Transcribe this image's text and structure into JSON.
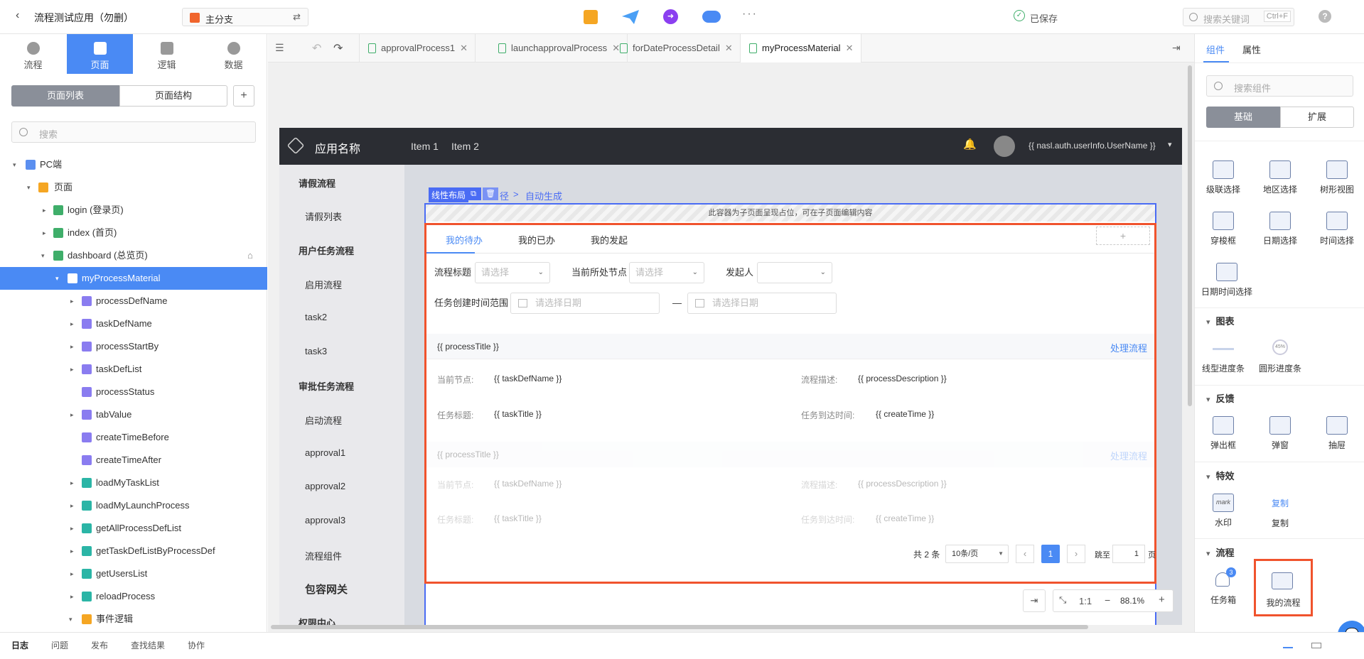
{
  "topbar": {
    "app_title": "流程测试应用（勿删）",
    "branch": "主分支",
    "saved_status": "已保存",
    "search_placeholder": "搜索关键词",
    "search_shortcut": "Ctrl+F",
    "help": "?"
  },
  "left": {
    "mode_tabs": [
      {
        "label": "流程"
      },
      {
        "label": "页面"
      },
      {
        "label": "逻辑"
      },
      {
        "label": "数据"
      }
    ],
    "view_tabs": [
      {
        "label": "页面列表"
      },
      {
        "label": "页面结构"
      }
    ],
    "add": "+",
    "search_placeholder": "搜索",
    "tree": [
      {
        "label": "PC端"
      },
      {
        "label": "页面"
      },
      {
        "label": "login (登录页)"
      },
      {
        "label": "index (首页)"
      },
      {
        "label": "dashboard (总览页)"
      },
      {
        "label": "myProcessMaterial"
      },
      {
        "label": "processDefName"
      },
      {
        "label": "taskDefName"
      },
      {
        "label": "processStartBy"
      },
      {
        "label": "taskDefList"
      },
      {
        "label": "processStatus"
      },
      {
        "label": "tabValue"
      },
      {
        "label": "createTimeBefore"
      },
      {
        "label": "createTimeAfter"
      },
      {
        "label": "loadMyTaskList"
      },
      {
        "label": "loadMyLaunchProcess"
      },
      {
        "label": "getAllProcessDefList"
      },
      {
        "label": "getTaskDefListByProcessDef"
      },
      {
        "label": "getUsersList"
      },
      {
        "label": "reloadProcess"
      },
      {
        "label": "事件逻辑"
      }
    ]
  },
  "editor_tabs": [
    {
      "label": "approvalProcess1"
    },
    {
      "label": "launchapprovalProcess"
    },
    {
      "label": "forDateProcessDetail"
    },
    {
      "label": "myProcessMaterial"
    }
  ],
  "canvas": {
    "app_name": "应用名称",
    "nav_items": [
      {
        "label": "Item 1"
      },
      {
        "label": "Item 2"
      }
    ],
    "username": "{{ nasl.auth.userInfo.UserName }}",
    "side_nav": [
      {
        "label": "请假流程"
      },
      {
        "label": "请假列表"
      },
      {
        "label": "用户任务流程"
      },
      {
        "label": "启用流程"
      },
      {
        "label": "task2"
      },
      {
        "label": "task3"
      },
      {
        "label": "审批任务流程"
      },
      {
        "label": "启动流程"
      },
      {
        "label": "approval1"
      },
      {
        "label": "approval2"
      },
      {
        "label": "approval3"
      },
      {
        "label": "流程组件"
      },
      {
        "label": "包容网关"
      },
      {
        "label": "权限中心"
      }
    ],
    "layout_badge": "线性布局",
    "breadcrumb_partial": "径",
    "breadcrumb_sep": ">",
    "breadcrumb_auto": "自动生成",
    "placeholder_note": "此容器为子页面呈现占位，可在子页面编辑内容",
    "tabs": [
      {
        "label": "我的待办"
      },
      {
        "label": "我的已办"
      },
      {
        "label": "我的发起"
      }
    ],
    "tab_add": "+",
    "filters": {
      "title_label": "流程标题",
      "title_placeholder": "请选择",
      "node_label": "当前所处节点",
      "node_placeholder": "请选择",
      "initiator_label": "发起人",
      "range_label": "任务创建时间范围",
      "date_placeholder_1": "请选择日期",
      "date_sep": "—",
      "date_placeholder_2": "请选择日期"
    },
    "card": {
      "title": "{{ processTitle }}",
      "action": "处理流程",
      "k1": "当前节点:",
      "v1": "{{ taskDefName }}",
      "k2": "流程描述:",
      "v2": "{{ processDescription }}",
      "k3": "任务标题:",
      "v3": "{{ taskTitle }}",
      "k4": "任务到达时间:",
      "v4": "{{ createTime }}"
    },
    "pagination": {
      "total": "共 2 条",
      "page_size": "10条/页",
      "prev": "‹",
      "current": "1",
      "next": "›",
      "goto_label": "跳至",
      "goto_value": "1",
      "page_suffix": "页"
    },
    "zoom": {
      "ratio": "1:1",
      "minus": "−",
      "value": "88.1%",
      "plus": "+"
    }
  },
  "right": {
    "tabs": [
      {
        "label": "组件"
      },
      {
        "label": "属性"
      }
    ],
    "search_placeholder": "搜索组件",
    "toggle": [
      {
        "label": "基础"
      },
      {
        "label": "扩展"
      }
    ],
    "items_top": [
      {
        "label": "级联选择"
      },
      {
        "label": "地区选择"
      },
      {
        "label": "树形视图"
      },
      {
        "label": "穿梭框"
      },
      {
        "label": "日期选择"
      },
      {
        "label": "时间选择"
      },
      {
        "label": "日期时间选择"
      }
    ],
    "sections": [
      {
        "title": "图表",
        "items": [
          {
            "label": "线型进度条"
          },
          {
            "label": "圆形进度条",
            "badge": "45%"
          }
        ]
      },
      {
        "title": "反馈",
        "items": [
          {
            "label": "弹出框"
          },
          {
            "label": "弹窗"
          },
          {
            "label": "抽屉"
          }
        ]
      },
      {
        "title": "特效",
        "items": [
          {
            "label": "水印",
            "icon_text": "mark"
          },
          {
            "label": "复制",
            "icon_text": "复制"
          }
        ]
      },
      {
        "title": "流程",
        "items": [
          {
            "label": "任务箱",
            "badge": "3"
          },
          {
            "label": "我的流程"
          }
        ]
      }
    ]
  },
  "bottom": {
    "tabs": [
      {
        "label": "日志"
      },
      {
        "label": "问题"
      },
      {
        "label": "发布"
      },
      {
        "label": "查找结果"
      },
      {
        "label": "协作"
      }
    ]
  },
  "colors": {
    "accent": "#4a8af4",
    "highlight": "#f0532d",
    "dark_header": "#2b2d33",
    "green": "#3fae6a"
  }
}
